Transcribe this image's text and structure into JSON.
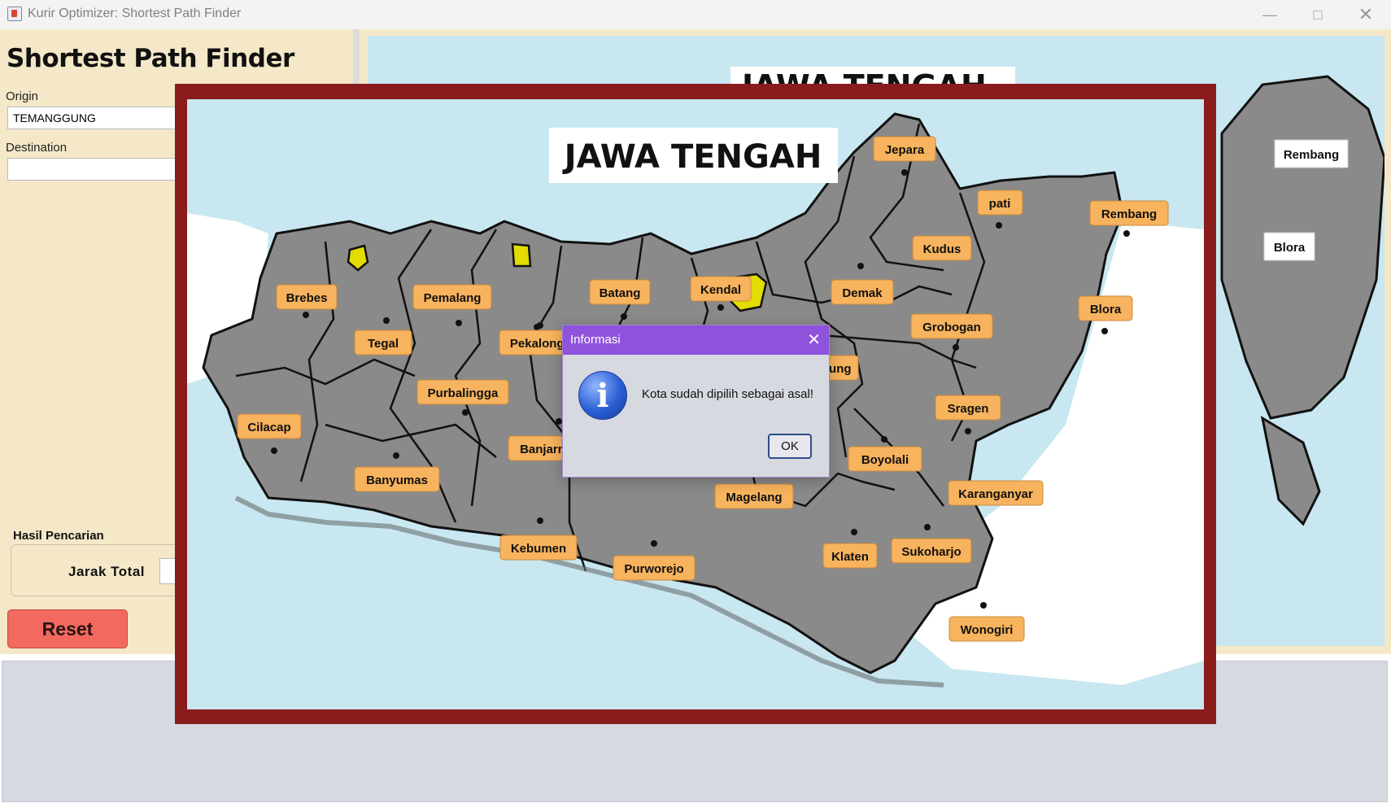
{
  "window": {
    "title": "Kurir Optimizer: Shortest Path Finder"
  },
  "app": {
    "heading": "Shortest Path Finder",
    "origin_label": "Origin",
    "origin_value": "TEMANGGUNG",
    "destination_label": "Destination",
    "destination_value": "",
    "result_section": "Hasil Pencarian",
    "total_distance_label": "Jarak Total",
    "total_distance_value": "",
    "reset_label": "Reset"
  },
  "map": {
    "title": "JAWA TENGAH",
    "background_partial_title": "JAWA TENGAH",
    "background_labels": [
      "Rembang",
      "Blora"
    ],
    "cities": [
      "Jepara",
      "pati",
      "Kudus",
      "Rembang",
      "Brebes",
      "Pemalang",
      "Batang",
      "Kendal",
      "Demak",
      "Blora",
      "Tegal",
      "Pekalongan",
      "Grobogan",
      "Purbalingga",
      "Temanggung",
      "Sragen",
      "Cilacap",
      "Banjarnegara",
      "Boyolali",
      "Banyumas",
      "Magelang",
      "Karanganyar",
      "Kebumen",
      "Purworejo",
      "Klaten",
      "Sukoharjo",
      "Wonogiri"
    ]
  },
  "dialog": {
    "title": "Informasi",
    "message": "Kota sudah dipilih sebagai asal!",
    "ok_label": "OK"
  },
  "colors": {
    "panel_bg": "#f4e8c8",
    "popup_frame": "#8b1c1c",
    "sea": "#c8e7f0",
    "land": "#8a8a8a",
    "label_bg": "#f7b35d",
    "highlight": "#e2dc00",
    "dialog_title": "#8f52dc",
    "reset_button": "#f26a5f"
  }
}
